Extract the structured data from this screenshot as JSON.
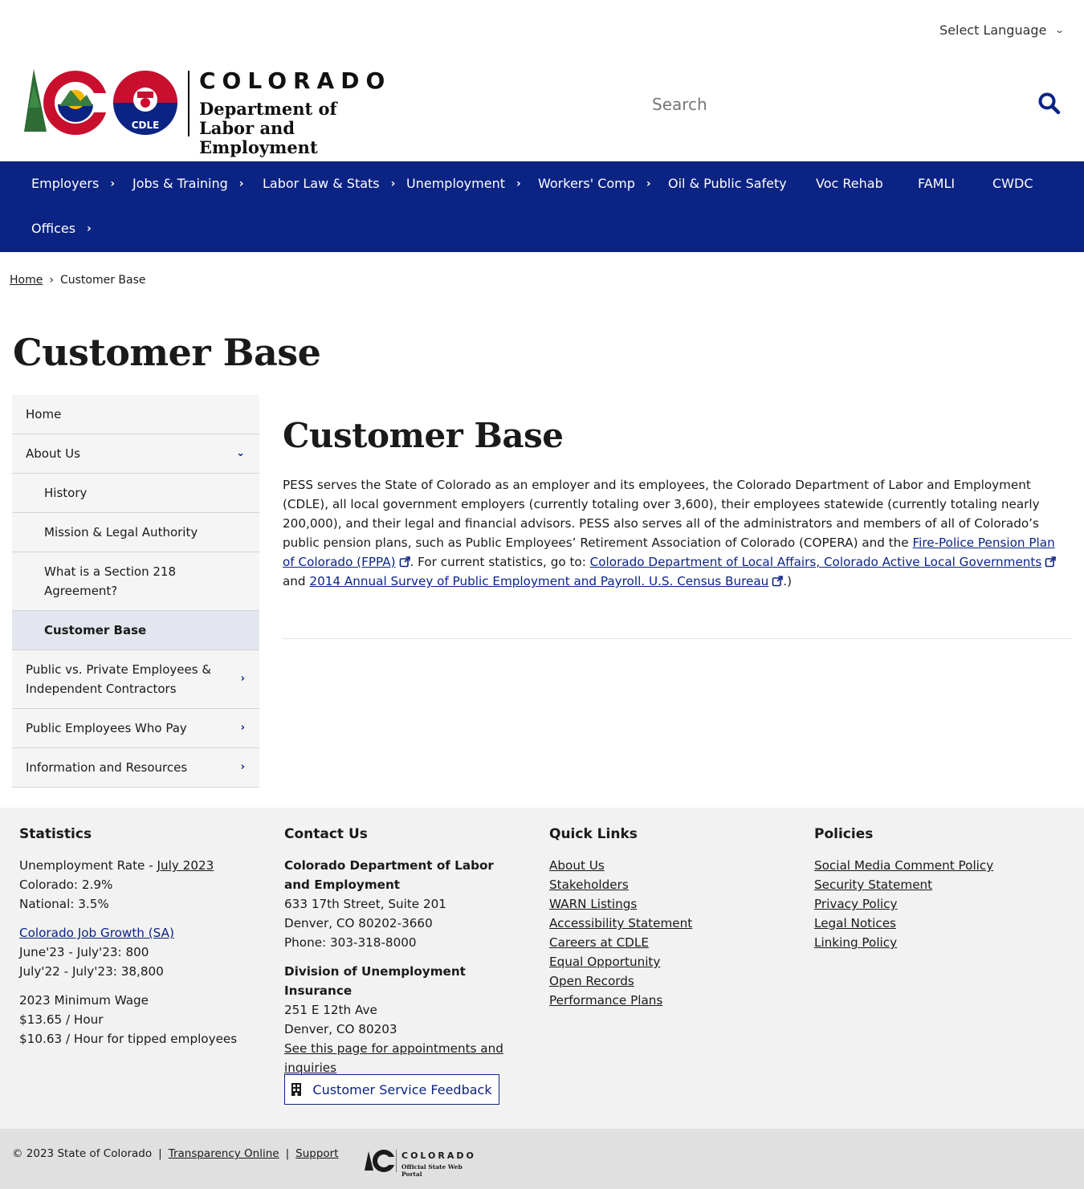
{
  "language": {
    "label": "Select Language"
  },
  "logo": {
    "state": "COLORADO",
    "dept_line1": "Department of",
    "dept_line2": "Labor and Employment",
    "badge": "CDLE"
  },
  "search": {
    "placeholder": "Search"
  },
  "nav": {
    "items": [
      {
        "label": "Employers",
        "has_children": true
      },
      {
        "label": "Jobs & Training",
        "has_children": true
      },
      {
        "label": "Labor Law & Stats",
        "has_children": true
      },
      {
        "label": "Unemployment",
        "has_children": true
      },
      {
        "label": "Workers' Comp",
        "has_children": true
      },
      {
        "label": "Oil & Public Safety",
        "has_children": false
      },
      {
        "label": "Voc Rehab",
        "has_children": false
      },
      {
        "label": "FAMLI",
        "has_children": false
      },
      {
        "label": "CWDC",
        "has_children": false
      },
      {
        "label": "Offices",
        "has_children": true
      }
    ]
  },
  "breadcrumb": {
    "home": "Home",
    "current": "Customer Base"
  },
  "page_title": "Customer Base",
  "sidebar": {
    "items": [
      {
        "label": "Home"
      },
      {
        "label": "About Us"
      },
      {
        "label": "History"
      },
      {
        "label": "Mission & Legal Authority"
      },
      {
        "label": "What is a Section 218 Agreement?"
      },
      {
        "label": "Customer Base"
      },
      {
        "label": "Public vs. Private Employees & Independent Contractors"
      },
      {
        "label": "Public Employees Who Pay"
      },
      {
        "label": "Information and Resources"
      }
    ]
  },
  "content": {
    "title": "Customer Base",
    "p1": "PESS serves the State of Colorado as an employer and its employees, the Colorado Department of Labor and Employment (CDLE), all local government employers (currently totaling over 3,600), their employees statewide (currently totaling nearly 200,000), and their legal and financial advisors.  PESS also serves all of the administrators and members of all of Colorado’s public pension plans, such as Public Employees’ Retirement Association of Colorado (COPERA) and the ",
    "link_fppa": "Fire-Police Pension Plan of Colorado (FPPA)",
    "p2": ".   For current statistics, go to:  ",
    "link_dola": "Colorado Department of Local Affairs, Colorado Active Local Governments",
    "p3": "  and ",
    "link_census": "2014 Annual Survey of Public Employment and Payroll. U.S. Census Bureau",
    "p4": ".)"
  },
  "footer": {
    "statistics": {
      "heading": "Statistics",
      "unemp_label": "Unemployment Rate - ",
      "unemp_link": "July 2023",
      "colorado": "Colorado: 2.9%",
      "national": "National: 3.5%",
      "jobs_link": "Colorado Job Growth (SA)",
      "jobs_1": "June'23 - July'23: 800",
      "jobs_2": "July'22 - July'23: 38,800",
      "wage_label": "2023 Minimum Wage",
      "wage_1": "$13.65 / Hour",
      "wage_2": "$10.63 / Hour for tipped employees"
    },
    "contact": {
      "heading": "Contact Us",
      "org": "Colorado Department of Labor and Employment",
      "addr1": "633 17th Street, Suite 201",
      "addr2": "Denver, CO  80202-3660",
      "phone": "Phone: 303-318-8000",
      "div": "Division of Unemployment Insurance",
      "div_addr1": "251 E 12th Ave",
      "div_addr2": "Denver, CO  80203",
      "appt_link": "See this page for appointments and inquiries",
      "feedback": "Customer Service Feedback"
    },
    "quick_links": {
      "heading": "Quick Links",
      "links": [
        "About Us",
        "Stakeholders",
        "WARN Listings",
        "Accessibility Statement",
        "Careers at CDLE",
        "Equal Opportunity",
        "Open Records",
        "Performance Plans"
      ]
    },
    "policies": {
      "heading": "Policies",
      "links": [
        "Social Media Comment Policy",
        "Security Statement",
        "Privacy Policy",
        "Legal Notices",
        "Linking Policy"
      ]
    }
  },
  "bottom": {
    "copyright": "© 2023 State of Colorado",
    "sep": "|",
    "transparency": "Transparency Online",
    "support": "Support",
    "portal_state": "COLORADO",
    "portal_sub": "Official State Web Portal"
  },
  "colors": {
    "navy": "#0b2383",
    "footer_bg": "#f2f2f2",
    "sidebar_bg": "#f5f5f5"
  },
  "icons": [
    "chevron-down-icon",
    "search-icon",
    "chevron-right-icon",
    "external-link-icon",
    "building-icon"
  ]
}
